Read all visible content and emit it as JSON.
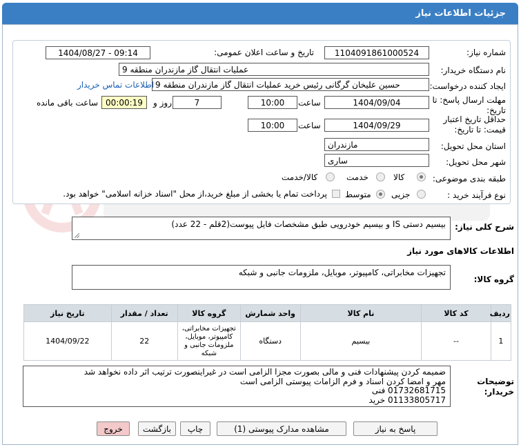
{
  "header": {
    "title": "جزئیات اطلاعات نیاز"
  },
  "form": {
    "need_number_label": "شماره نیاز:",
    "need_number": "1104091861000524",
    "announce_label": "تاریخ و ساعت اعلان عمومی:",
    "announce_value": "1404/08/27 - 09:14",
    "buyer_org_label": "نام دستگاه خریدار:",
    "buyer_org": "عملیات انتقال گاز مازندران منطقه 9",
    "creator_label": "ایجاد کننده درخواست:",
    "creator": "حسین علیخان گرگانی رئیس خرید عملیات انتقال گاز مازندران منطقه 9",
    "contact_link": "اطلاعات تماس خریدار",
    "reply_deadline_label": "مهلت ارسال پاسخ: تا تاریخ:",
    "reply_date": "1404/09/04",
    "time_label": "ساعت",
    "reply_time": "10:00",
    "days_value": "7",
    "days_label": "روز و",
    "remaining_time": "00:00:19",
    "remaining_label": "ساعت باقی مانده",
    "validity_label": "حداقل تاریخ اعتبار قیمت: تا تاریخ:",
    "validity_date": "1404/09/29",
    "validity_time": "10:00",
    "province_label": "استان محل تحویل:",
    "province": "مازندران",
    "city_label": "شهر محل تحویل:",
    "city": "ساری",
    "category_label": "طبقه بندی موضوعی:",
    "category_options": [
      "کالا",
      "خدمت",
      "کالا/خدمت"
    ],
    "process_label": "نوع فرآیند خرید :",
    "process_options": [
      "جزیی",
      "متوسط"
    ],
    "payment_note": "پرداخت تمام یا بخشی از مبلغ خرید،از محل \"اسناد خزانه اسلامی\" خواهد بود."
  },
  "description": {
    "label": "شرح کلی نیاز:",
    "text": "بیسیم دستی IS و بیسیم خودرویی طبق مشخصات فایل پیوست(2قلم - 22 عدد)"
  },
  "goods": {
    "section_title": "اطلاعات کالاهای مورد نیاز",
    "group_label": "گروه کالا:",
    "group_value": "تجهیزات مخابراتی، کامپیوتر، موبایل، ملزومات جانبی و شبکه"
  },
  "table": {
    "headers": [
      "ردیف",
      "کد کالا",
      "نام کالا",
      "واحد شمارش",
      "گروه کالا",
      "تعداد / مقدار",
      "تاریخ نیاز"
    ],
    "rows": [
      [
        "1",
        "--",
        "بیسیم",
        "دستگاه",
        "تجهیزات مخابراتی، کامپیوتر، موبایل، ملزومات جانبی و شبکه",
        "22",
        "1404/09/22"
      ]
    ]
  },
  "buyer_notes": {
    "label": "توضیحات خریدار:",
    "lines": [
      "ضمیمه کردن پیشنهادات فنی و مالی بصورت مجزا الزامی است در غیراینصورت ترتیب اثر داده  نخواهد شد",
      "مهر و امضا کردن اسناد  و فرم الزامات پیوستی الزامی است",
      "01732681715 فنی",
      "01133805717 خرید"
    ]
  },
  "buttons": {
    "reply": "پاسخ به نیاز",
    "attachments": "مشاهده مدارک پیوستی (1)",
    "print": "چاپ",
    "back": "بازگشت",
    "exit": "خروج"
  }
}
